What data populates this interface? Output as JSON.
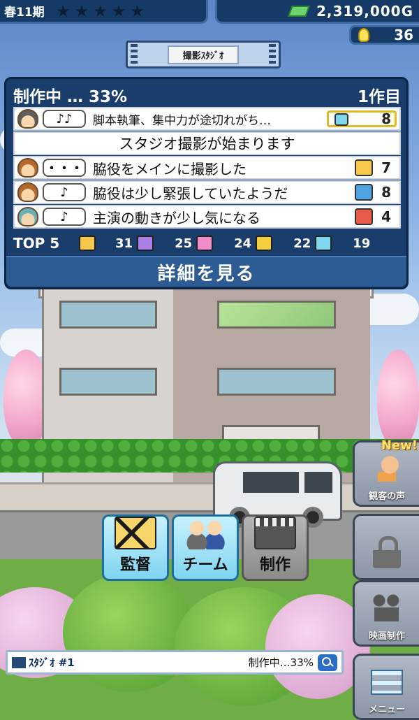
{
  "hud": {
    "season": "春11期",
    "money": "2,319,000G",
    "ideas": "36"
  },
  "location": {
    "label": "撮影ｽﾀｼﾞｵ"
  },
  "panel": {
    "status": "制作中 … 33%",
    "work_count": "1作目",
    "rows": [
      {
        "bubble": "♪♪",
        "text": "脚本執筆、集中力が途切れがち…",
        "score": "8",
        "genre_color": "#7ed6ee"
      },
      {
        "text": "スタジオ撮影が始まります"
      },
      {
        "bubble": "・・・",
        "text": "脇役をメインに撮影した",
        "score": "7",
        "genre_color": "#f5c84a"
      },
      {
        "bubble": "♪",
        "text": "脇役は少し緊張していたようだ",
        "score": "8",
        "genre_color": "#4da3e2"
      },
      {
        "bubble": "♪",
        "text": "主演の動きが少し気になる",
        "score": "4",
        "genre_color": "#e85a4a"
      }
    ],
    "top5": {
      "label": "TOP 5",
      "items": [
        {
          "value": "31",
          "genre_color": "#f5c84a"
        },
        {
          "value": "25",
          "genre_color": "#a880e6"
        },
        {
          "value": "24",
          "genre_color": "#f08cc9"
        },
        {
          "value": "22",
          "genre_color": "#f3cf3f"
        },
        {
          "value": "19",
          "genre_color": "#7ed6ee"
        }
      ]
    },
    "detail_button": "詳細を見る"
  },
  "actions": {
    "director": "監督",
    "team": "チーム",
    "produce": "制作"
  },
  "side": {
    "voice": "観客の声",
    "new_badge": "New!",
    "movie": "映画制作",
    "menu": "メニュー"
  },
  "status_bar": {
    "studio": "ｽﾀｼﾞｵ #1",
    "state": "制作中…33%"
  }
}
